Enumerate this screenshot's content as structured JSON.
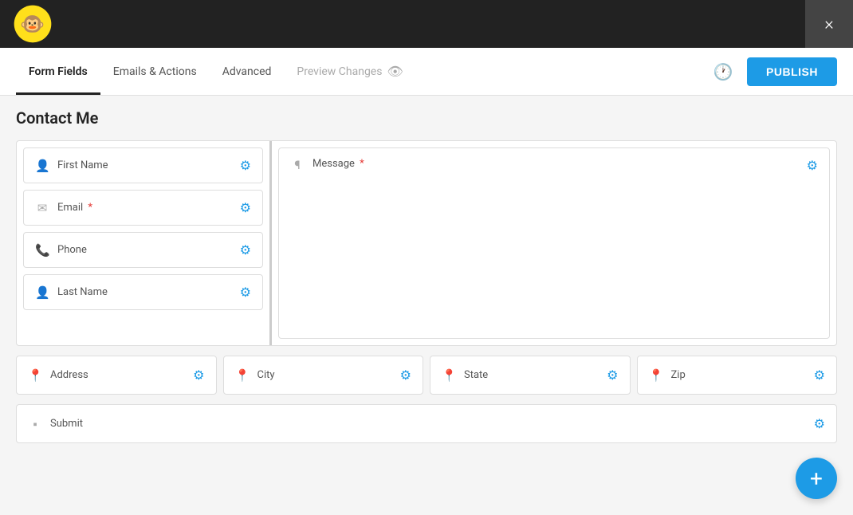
{
  "topbar": {
    "close_label": "×"
  },
  "nav": {
    "tabs": [
      {
        "id": "form-fields",
        "label": "Form Fields",
        "active": true
      },
      {
        "id": "emails-actions",
        "label": "Emails & Actions",
        "active": false
      },
      {
        "id": "advanced",
        "label": "Advanced",
        "active": false
      },
      {
        "id": "preview-changes",
        "label": "Preview Changes",
        "active": false,
        "preview": true
      }
    ],
    "publish_label": "PUBLISH"
  },
  "form": {
    "title": "Contact Me",
    "fields_left": [
      {
        "id": "first-name",
        "icon": "👤",
        "label": "First Name",
        "required": false
      },
      {
        "id": "email",
        "icon": "✉",
        "label": "Email",
        "required": true
      },
      {
        "id": "phone",
        "icon": "📞",
        "label": "Phone",
        "required": false
      },
      {
        "id": "last-name",
        "icon": "👤",
        "label": "Last Name",
        "required": false
      }
    ],
    "field_message": {
      "id": "message",
      "icon": "¶",
      "label": "Message",
      "required": true
    },
    "fields_bottom": [
      {
        "id": "address",
        "icon": "📍",
        "label": "Address"
      },
      {
        "id": "city",
        "icon": "📍",
        "label": "City"
      },
      {
        "id": "state",
        "icon": "📍",
        "label": "State"
      },
      {
        "id": "zip",
        "icon": "📍",
        "label": "Zip"
      }
    ],
    "submit": {
      "id": "submit",
      "icon": "▪",
      "label": "Submit"
    }
  },
  "fab": {
    "label": "+"
  }
}
